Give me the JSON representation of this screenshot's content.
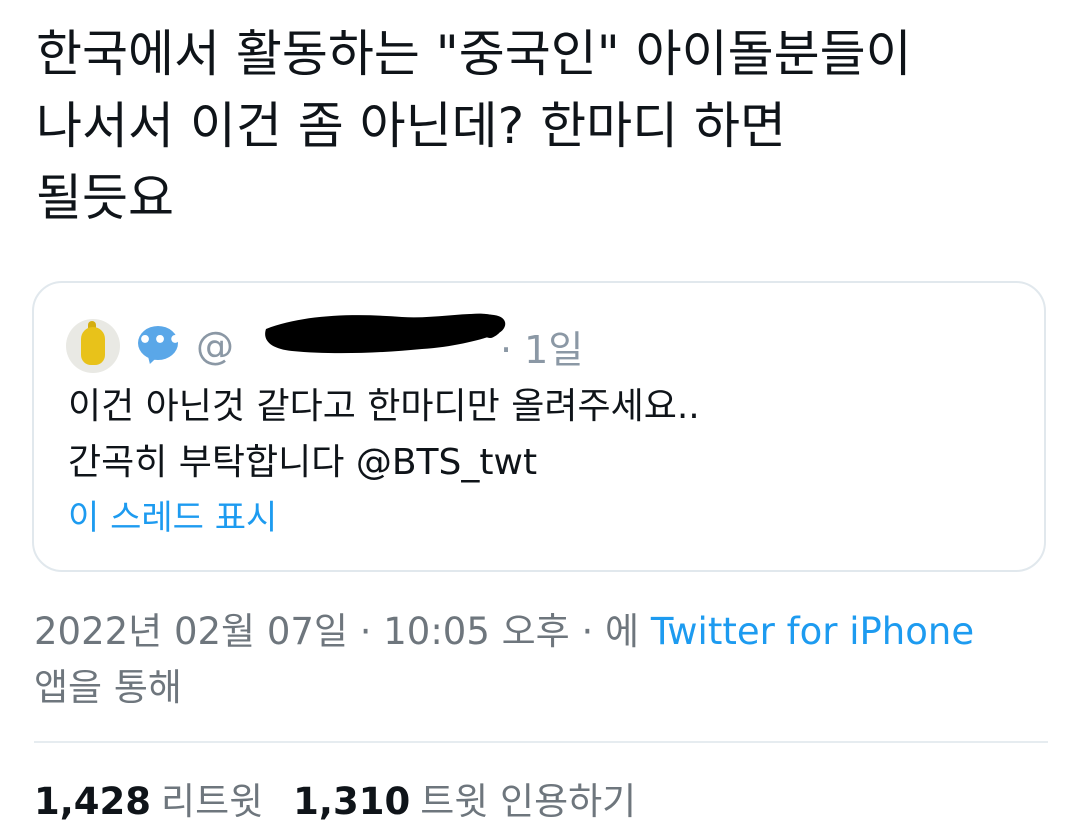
{
  "tweet": {
    "text_lines": [
      "한국에서 활동하는 \"중국인\" 아이돌분들이",
      "나서서 이건 좀 아닌데? 한마디 하면",
      "될듯요"
    ]
  },
  "quote": {
    "avatar_icon": "pikachu-avatar",
    "badge_icon": "speech-bubble-icon",
    "handle": "@",
    "time_ago": "· 1일",
    "body_lines": [
      "이건 아닌것 같다고 한마디만 올려주세요..",
      "간곡히 부탁합니다 @BTS_twt"
    ],
    "show_thread": "이 스레드 표시"
  },
  "meta": {
    "datetime": "2022년 02월 07일 · 10:05 오후 · 에 ",
    "app_name": "Twitter for iPhone",
    "via_suffix": "앱을 통해"
  },
  "stats": {
    "retweets_count": "1,428",
    "retweets_label": "리트윗",
    "quotes_count": "1,310",
    "quotes_label": "트윗 인용하기"
  },
  "colors": {
    "link": "#1d9bf0",
    "muted": "#6e767d",
    "text": "#0f1419"
  }
}
